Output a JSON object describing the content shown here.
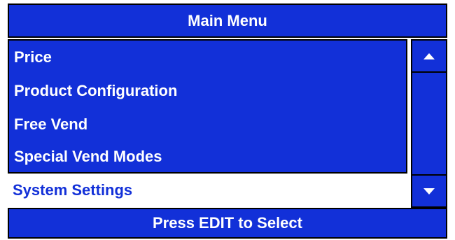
{
  "header": {
    "title": "Main Menu"
  },
  "menu": {
    "items": [
      {
        "label": "Price"
      },
      {
        "label": "Product Configuration"
      },
      {
        "label": "Free Vend"
      },
      {
        "label": "Special Vend Modes"
      }
    ],
    "selected": {
      "label": "System Settings"
    }
  },
  "scrollbar": {
    "up_icon": "triangle-up-icon",
    "down_icon": "triangle-down-icon"
  },
  "footer": {
    "text": "Press EDIT to Select"
  },
  "colors": {
    "panel_blue": "#1230d8",
    "text_white": "#ffffff",
    "selected_text": "#1230d8",
    "border": "#000000"
  }
}
